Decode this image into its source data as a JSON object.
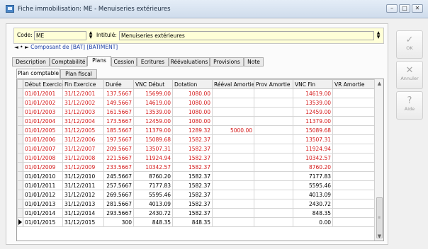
{
  "window": {
    "title": "Fiche immobilisation: ME - Menuiseries extérieures",
    "controls": [
      "minimize",
      "maximize",
      "close"
    ]
  },
  "header": {
    "code_label": "Code:",
    "code_value": "ME",
    "intitule_label": "Intitulé:",
    "intitule_value": "Menuiseries extérieures",
    "composant_text": "Composant de [BAT] [BATIMENT]"
  },
  "tabs": [
    "Description",
    "Comptabilité",
    "Plans",
    "Cession",
    "Ecritures",
    "Réévaluations",
    "Provisions",
    "Note"
  ],
  "active_tab": "Plans",
  "subtabs": [
    "Plan comptable",
    "Plan fiscal"
  ],
  "active_subtab": "Plan comptable",
  "grid": {
    "columns": [
      "Début Exercice",
      "Fin Exercice",
      "Durée",
      "VNC Début",
      "Dotation",
      "Rééval Amortie",
      "Prov Amortie",
      "VNC Fin",
      "VR Amortie"
    ],
    "rows": [
      {
        "debut": "01/01/2001",
        "fin": "31/12/2001",
        "duree": "137.5667",
        "vnc_debut": "15699.00",
        "dotation": "1080.00",
        "reeval": "",
        "prov": "",
        "vnc_fin": "14619.00",
        "vr": "",
        "red": true
      },
      {
        "debut": "01/01/2002",
        "fin": "31/12/2002",
        "duree": "149.5667",
        "vnc_debut": "14619.00",
        "dotation": "1080.00",
        "reeval": "",
        "prov": "",
        "vnc_fin": "13539.00",
        "vr": "",
        "red": true
      },
      {
        "debut": "01/01/2003",
        "fin": "31/12/2003",
        "duree": "161.5667",
        "vnc_debut": "13539.00",
        "dotation": "1080.00",
        "reeval": "",
        "prov": "",
        "vnc_fin": "12459.00",
        "vr": "",
        "red": true
      },
      {
        "debut": "01/01/2004",
        "fin": "31/12/2004",
        "duree": "173.5667",
        "vnc_debut": "12459.00",
        "dotation": "1080.00",
        "reeval": "",
        "prov": "",
        "vnc_fin": "11379.00",
        "vr": "",
        "red": true
      },
      {
        "debut": "01/01/2005",
        "fin": "31/12/2005",
        "duree": "185.5667",
        "vnc_debut": "11379.00",
        "dotation": "1289.32",
        "reeval": "5000.00",
        "prov": "",
        "vnc_fin": "15089.68",
        "vr": "",
        "red": true
      },
      {
        "debut": "01/01/2006",
        "fin": "31/12/2006",
        "duree": "197.5667",
        "vnc_debut": "15089.68",
        "dotation": "1582.37",
        "reeval": "",
        "prov": "",
        "vnc_fin": "13507.31",
        "vr": "",
        "red": true
      },
      {
        "debut": "01/01/2007",
        "fin": "31/12/2007",
        "duree": "209.5667",
        "vnc_debut": "13507.31",
        "dotation": "1582.37",
        "reeval": "",
        "prov": "",
        "vnc_fin": "11924.94",
        "vr": "",
        "red": true
      },
      {
        "debut": "01/01/2008",
        "fin": "31/12/2008",
        "duree": "221.5667",
        "vnc_debut": "11924.94",
        "dotation": "1582.37",
        "reeval": "",
        "prov": "",
        "vnc_fin": "10342.57",
        "vr": "",
        "red": true
      },
      {
        "debut": "01/01/2009",
        "fin": "31/12/2009",
        "duree": "233.5667",
        "vnc_debut": "10342.57",
        "dotation": "1582.37",
        "reeval": "",
        "prov": "",
        "vnc_fin": "8760.20",
        "vr": "",
        "red": true
      },
      {
        "debut": "01/01/2010",
        "fin": "31/12/2010",
        "duree": "245.5667",
        "vnc_debut": "8760.20",
        "dotation": "1582.37",
        "reeval": "",
        "prov": "",
        "vnc_fin": "7177.83",
        "vr": "",
        "red": false
      },
      {
        "debut": "01/01/2011",
        "fin": "31/12/2011",
        "duree": "257.5667",
        "vnc_debut": "7177.83",
        "dotation": "1582.37",
        "reeval": "",
        "prov": "",
        "vnc_fin": "5595.46",
        "vr": "",
        "red": false
      },
      {
        "debut": "01/01/2012",
        "fin": "31/12/2012",
        "duree": "269.5667",
        "vnc_debut": "5595.46",
        "dotation": "1582.37",
        "reeval": "",
        "prov": "",
        "vnc_fin": "4013.09",
        "vr": "",
        "red": false
      },
      {
        "debut": "01/01/2013",
        "fin": "31/12/2013",
        "duree": "281.5667",
        "vnc_debut": "4013.09",
        "dotation": "1582.37",
        "reeval": "",
        "prov": "",
        "vnc_fin": "2430.72",
        "vr": "",
        "red": false
      },
      {
        "debut": "01/01/2014",
        "fin": "31/12/2014",
        "duree": "293.5667",
        "vnc_debut": "2430.72",
        "dotation": "1582.37",
        "reeval": "",
        "prov": "",
        "vnc_fin": "848.35",
        "vr": "",
        "red": false
      },
      {
        "debut": "01/01/2015",
        "fin": "31/12/2015",
        "duree": "300",
        "vnc_debut": "848.35",
        "dotation": "848.35",
        "reeval": "",
        "prov": "",
        "vnc_fin": "0.00",
        "vr": "",
        "red": false,
        "current": true
      }
    ]
  },
  "side_buttons": [
    "OK",
    "Annuler",
    "Aide"
  ],
  "colors": {
    "overdue_row_text": "#d41919",
    "header_field_bg": "#ffffd7",
    "link_text": "#1f43a8"
  }
}
